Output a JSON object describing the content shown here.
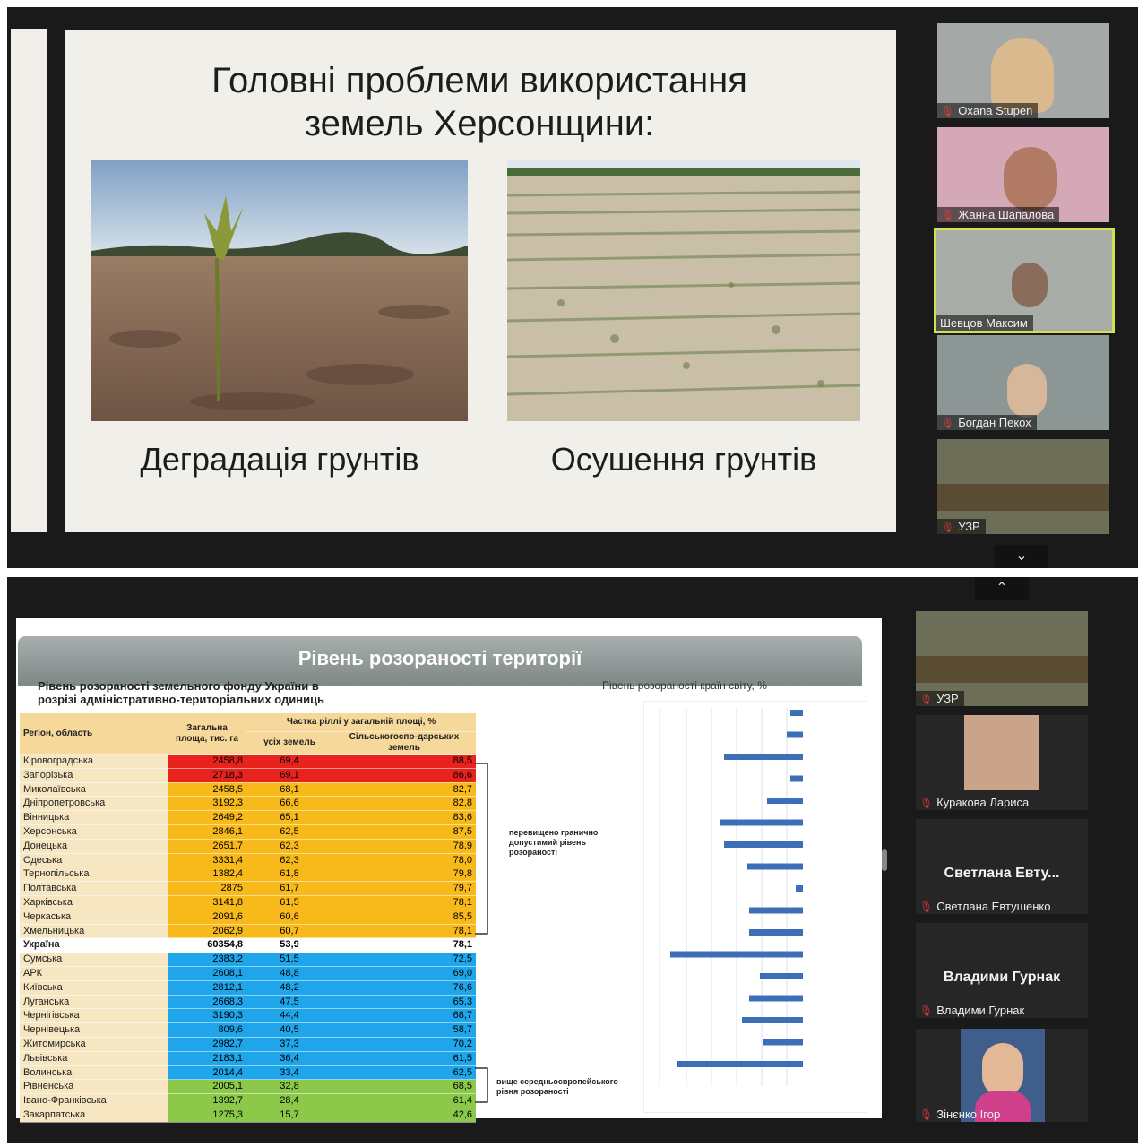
{
  "window1": {
    "slide": {
      "title_line1": "Головні проблеми використання",
      "title_line2": "земель Херсонщини:",
      "caption_left": "Деградація грунтів",
      "caption_right": "Осушення грунтів"
    },
    "participants": [
      {
        "name": "Oxana Stupen"
      },
      {
        "name": "Жанна Шапалова"
      },
      {
        "name": "Шевцов Максим"
      },
      {
        "name": "Богдан Пекох"
      },
      {
        "name": "УЗР"
      }
    ]
  },
  "window2": {
    "slide": {
      "title": "Рівень розораності території",
      "subtitle_line1": "Рівень розораності земельного фонду України в",
      "subtitle_line2": "розрізі адміністративно-територіальних одиниць",
      "chart_title": "Рівень розораності країн світу, %",
      "table": {
        "headers": {
          "region": "Регіон, область",
          "total": "Загальна площа, тис. га",
          "share": "Частка ріллі у загальній площі, %",
          "all_land": "усіх земель",
          "agri_land": "Сільськогоспо-дарських земель"
        },
        "rows": [
          {
            "region": "Кіровоградська",
            "total": "2458,8",
            "all": "69,4",
            "agri": "88,5",
            "zone": "red"
          },
          {
            "region": "Запорізька",
            "total": "2718,3",
            "all": "69,1",
            "agri": "86,6",
            "zone": "red"
          },
          {
            "region": "Миколаївська",
            "total": "2458,5",
            "all": "68,1",
            "agri": "82,7",
            "zone": "orange"
          },
          {
            "region": "Дніпропетровська",
            "total": "3192,3",
            "all": "66,6",
            "agri": "82,8",
            "zone": "orange"
          },
          {
            "region": "Вінницька",
            "total": "2649,2",
            "all": "65,1",
            "agri": "83,6",
            "zone": "orange"
          },
          {
            "region": "Херсонська",
            "total": "2846,1",
            "all": "62,5",
            "agri": "87,5",
            "zone": "orange"
          },
          {
            "region": "Донецька",
            "total": "2651,7",
            "all": "62,3",
            "agri": "78,9",
            "zone": "orange"
          },
          {
            "region": "Одеська",
            "total": "3331,4",
            "all": "62,3",
            "agri": "78,0",
            "zone": "orange"
          },
          {
            "region": "Тернопільська",
            "total": "1382,4",
            "all": "61,8",
            "agri": "79,8",
            "zone": "orange"
          },
          {
            "region": "Полтавська",
            "total": "2875",
            "all": "61,7",
            "agri": "79,7",
            "zone": "orange"
          },
          {
            "region": "Харківська",
            "total": "3141,8",
            "all": "61,5",
            "agri": "78,1",
            "zone": "orange"
          },
          {
            "region": "Черкаська",
            "total": "2091,6",
            "all": "60,6",
            "agri": "85,5",
            "zone": "orange"
          },
          {
            "region": "Хмельницька",
            "total": "2062,9",
            "all": "60,7",
            "agri": "78,1",
            "zone": "orange"
          },
          {
            "region": "Україна",
            "total": "60354,8",
            "all": "53,9",
            "agri": "78,1",
            "zone": "white"
          },
          {
            "region": "Сумська",
            "total": "2383,2",
            "all": "51,5",
            "agri": "72,5",
            "zone": "blue"
          },
          {
            "region": "АРК",
            "total": "2608,1",
            "all": "48,8",
            "agri": "69,0",
            "zone": "blue"
          },
          {
            "region": "Київська",
            "total": "2812,1",
            "all": "48,2",
            "agri": "76,6",
            "zone": "blue"
          },
          {
            "region": "Луганська",
            "total": "2668,3",
            "all": "47,5",
            "agri": "65,3",
            "zone": "blue"
          },
          {
            "region": "Чернігівська",
            "total": "3190,3",
            "all": "44,4",
            "agri": "68,7",
            "zone": "blue"
          },
          {
            "region": "Чернівецька",
            "total": "809,6",
            "all": "40,5",
            "agri": "58,7",
            "zone": "blue"
          },
          {
            "region": "Житомирська",
            "total": "2982,7",
            "all": "37,3",
            "agri": "70,2",
            "zone": "blue"
          },
          {
            "region": "Львівська",
            "total": "2183,1",
            "all": "36,4",
            "agri": "61,5",
            "zone": "blue"
          },
          {
            "region": "Волинська",
            "total": "2014,4",
            "all": "33,4",
            "agri": "62,5",
            "zone": "blue"
          },
          {
            "region": "Рівненська",
            "total": "2005,1",
            "all": "32,8",
            "agri": "68,5",
            "zone": "green"
          },
          {
            "region": "Івано-Франківська",
            "total": "1392,7",
            "all": "28,4",
            "agri": "61,4",
            "zone": "green"
          },
          {
            "region": "Закарпатська",
            "total": "1275,3",
            "all": "15,7",
            "agri": "42,6",
            "zone": "green"
          }
        ]
      },
      "annotation_top": "перевищено гранично допустимий рівень розораності",
      "annotation_bottom": "вище середньоєвропейського рівня розораності"
    },
    "participants": [
      {
        "name": "УЗР",
        "type": "video"
      },
      {
        "name": "Куракова Лариса",
        "type": "video"
      },
      {
        "name": "Светлана Евтушенко",
        "display": "Светлана Евту...",
        "type": "name-only"
      },
      {
        "name": "Владими Гурнак",
        "display": "Владими Гурнак",
        "type": "name-only"
      },
      {
        "name": "Зінєнко Ігор",
        "type": "video"
      }
    ]
  },
  "colors": {
    "red": "#e8221d",
    "orange": "#f8b91b",
    "blue": "#1fa5ea",
    "green": "#8cc94a",
    "bar": "#3d6fb8",
    "active_border": "#d5e04a"
  },
  "icons": [
    "mic-muted-icon",
    "chevron-down-icon",
    "chevron-up-icon"
  ]
}
